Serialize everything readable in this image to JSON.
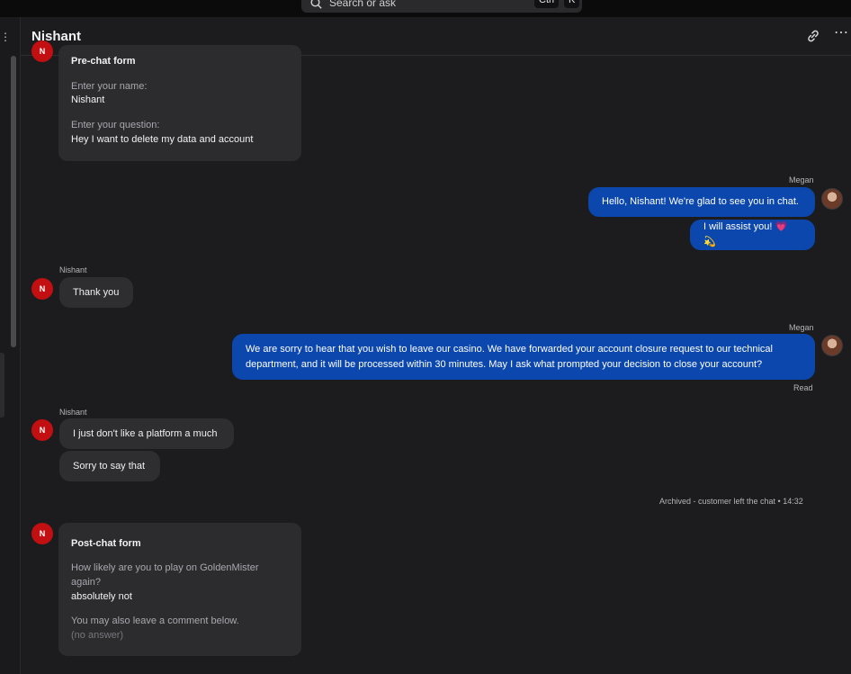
{
  "search": {
    "placeholder": "Search or ask",
    "kbd1": "Ctrl",
    "kbd2": "K"
  },
  "header": {
    "title": "Nishant"
  },
  "prechat": {
    "title": "Pre-chat form",
    "q1_label": "Enter your name:",
    "q1_value": "Nishant",
    "q2_label": "Enter your question:",
    "q2_value": "Hey I want to delete my data and account"
  },
  "messages": {
    "agent_name": "Megan",
    "customer_name": "Nishant",
    "avatar_initial": "N",
    "m1": "Hello, Nishant! We're glad to see you in chat.",
    "m2": "I will assist you! 💗 💫",
    "m3": "Thank you",
    "m4_line1": "We are sorry to hear that you wish to leave our casino. We have forwarded your account closure request to our technical",
    "m4_line2": "department, and it will be processed within 30 minutes. May I ask what prompted your decision to close your account?",
    "read": "Read",
    "m5": "I just don't like a platform a much",
    "m6": "Sorry to say that"
  },
  "system": {
    "archived": "Archived - customer left the chat • 14:32"
  },
  "postchat": {
    "title": "Post-chat form",
    "q1_line1": "How likely are you to play on GoldenMister",
    "q1_line2": "again?",
    "q1_value": "absolutely not",
    "q2_label": "You may also leave a comment below.",
    "q2_value": "(no answer)"
  },
  "colors": {
    "agent_bubble": "#0b47ad",
    "customer_avatar": "#c20f12",
    "background": "#1c1c1e"
  }
}
